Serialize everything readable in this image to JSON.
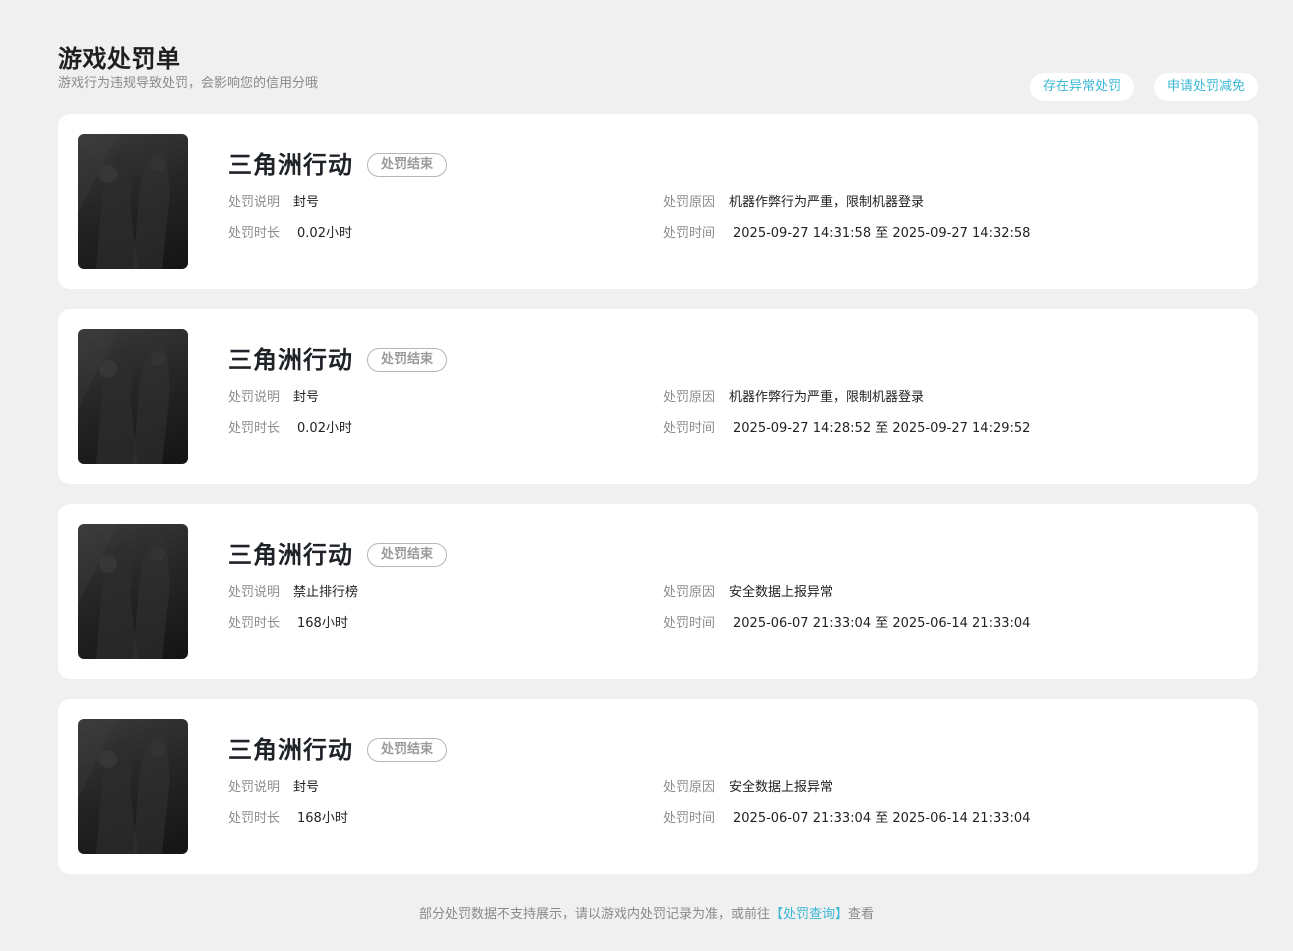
{
  "header": {
    "title": "游戏处罚单",
    "subtitle": "游戏行为违规导致处罚，会影响您的信用分哦",
    "actions": {
      "abnormal_label": "存在异常处罚",
      "appeal_label": "申请处罚减免"
    }
  },
  "labels": {
    "desc": "处罚说明",
    "duration": "处罚时长",
    "reason": "处罚原因",
    "time": "处罚时间"
  },
  "records": [
    {
      "game": "三角洲行动",
      "status": "处罚结束",
      "desc": "封号",
      "duration": "0.02小时",
      "reason": "机器作弊行为严重，限制机器登录",
      "time": "2025-09-27 14:31:58 至 2025-09-27 14:32:58"
    },
    {
      "game": "三角洲行动",
      "status": "处罚结束",
      "desc": "封号",
      "duration": "0.02小时",
      "reason": "机器作弊行为严重，限制机器登录",
      "time": "2025-09-27 14:28:52 至 2025-09-27 14:29:52"
    },
    {
      "game": "三角洲行动",
      "status": "处罚结束",
      "desc": "禁止排行榜",
      "duration": "168小时",
      "reason": "安全数据上报异常",
      "time": "2025-06-07 21:33:04 至 2025-06-14 21:33:04"
    },
    {
      "game": "三角洲行动",
      "status": "处罚结束",
      "desc": "封号",
      "duration": "168小时",
      "reason": "安全数据上报异常",
      "time": "2025-06-07 21:33:04 至 2025-06-14 21:33:04"
    }
  ],
  "footer": {
    "text": "部分处罚数据不支持展示，请以游戏内处罚记录为准，或前往",
    "link": "【处罚查询】",
    "tail": "查看"
  },
  "colors": {
    "accent": "#3bb8d6",
    "background": "#f0f0f0",
    "card": "#ffffff"
  }
}
